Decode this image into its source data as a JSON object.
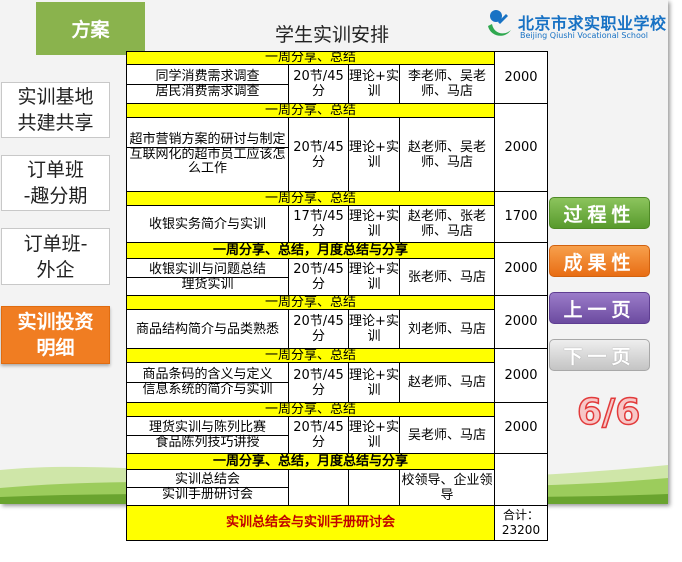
{
  "header": {
    "tab_label": "方案",
    "title": "学生实训安排",
    "logo_name": "北京市求实职业学校",
    "logo_english": "Beijing Qiushi Vocational School"
  },
  "left_nav": [
    {
      "label": "实训基地\n共建共享"
    },
    {
      "label": "订单班\n-趣分期"
    },
    {
      "label": "订单班-\n外企"
    },
    {
      "label": "实训投资\n明细"
    }
  ],
  "right_buttons": {
    "process": "过程性",
    "result": "成果性",
    "prev": "上一页",
    "next": "下一页"
  },
  "page_indicator": "6/6",
  "schedule": {
    "weekly_label": "一周分享、总结",
    "monthly_label": "一周分享、总结，月度总结与分享",
    "blocks": [
      {
        "items": [
          "同学消费需求调查",
          "居民消费需求调查"
        ],
        "hours": "20节/45分",
        "type": "理论+实训",
        "teachers": "李老师、吴老师、马店",
        "cost": "2000"
      },
      {
        "items": [
          "超市营销方案的研讨与制定",
          "互联网化的超市员工应该怎么工作"
        ],
        "hours": "20节/45分",
        "type": "理论+实训",
        "teachers": "赵老师、吴老师、马店",
        "cost": "2000"
      },
      {
        "items": [
          "收银实务简介与实训"
        ],
        "hours": "17节/45分",
        "type": "理论+实训",
        "teachers": "赵老师、张老师、马店",
        "cost": "1700"
      },
      {
        "items": [
          "收银实训与问题总结",
          "理货实训"
        ],
        "hours": "20节/45分",
        "type": "理论+实训",
        "teachers": "张老师、马店",
        "cost": "2000"
      },
      {
        "items": [
          "商品结构简介与品类熟悉"
        ],
        "hours": "20节/45分",
        "type": "理论+实训",
        "teachers": "刘老师、马店",
        "cost": "2000"
      },
      {
        "items": [
          "商品条码的含义与定义",
          "信息系统的简介与实训"
        ],
        "hours": "20节/45分",
        "type": "理论+实训",
        "teachers": "赵老师、马店",
        "cost": "2000"
      },
      {
        "items": [
          "理货实训与陈列比赛",
          "食品陈列技巧讲授"
        ],
        "hours": "20节/45分",
        "type": "理论+实训",
        "teachers": "吴老师、马店",
        "cost": "2000"
      }
    ],
    "summary": {
      "items": [
        "实训总结会",
        "实训手册研讨会"
      ],
      "teachers": "校领导、企业领导"
    },
    "footer_label": "实训总结会与实训手册研讨会",
    "total": "合计：23200"
  },
  "colors": {
    "tab_green": "#8ab34d",
    "row_yellow": "#ffff00",
    "nav_active_orange": "#f07d22",
    "footer_red_text": "#c00000"
  }
}
